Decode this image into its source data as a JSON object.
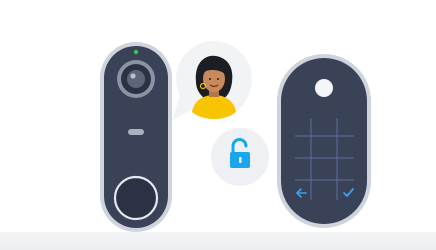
{
  "scene": {
    "doorbell": {
      "status_led": "on"
    },
    "visitor_bubble": {
      "avatar": "woman-avatar-icon"
    },
    "unlock_bubble": {
      "icon": "unlocked-padlock-icon"
    },
    "keypad": {
      "controls": [
        "back-arrow-icon",
        "checkmark-icon"
      ]
    }
  },
  "colors": {
    "device_body": "#3a4258",
    "device_trim": "#cfd4dc",
    "accent_blue": "#3aa0f0",
    "shirt_yellow": "#f8c400",
    "skin": "#c88a5a",
    "hair": "#1d1d24",
    "led_green": "#2ecc4a"
  }
}
